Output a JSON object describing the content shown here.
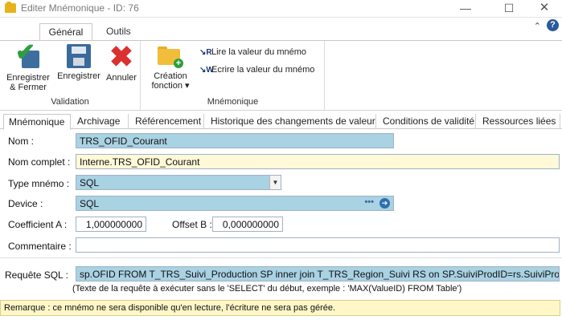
{
  "window": {
    "title": "Editer Mnémonique - ID: 76",
    "minimize": "—",
    "maximize": "☐",
    "close": "✕"
  },
  "ribbon": {
    "tabs": [
      {
        "label": "Général",
        "active": true
      },
      {
        "label": "Outils",
        "active": false
      }
    ],
    "collapse_glyph": "⌃",
    "help_glyph": "?",
    "groups": {
      "validation": {
        "label": "Validation",
        "buttons": {
          "save_close": "Enregistrer & Fermer",
          "save": "Enregistrer",
          "cancel": "Annuler"
        }
      },
      "mnemonique": {
        "label": "Mnémonique",
        "create_function": "Création fonction",
        "create_function_arrow": "▾",
        "read_value": "Lire la valeur du mnémo",
        "write_value": "Ecrire la valeur du mnémo"
      }
    }
  },
  "form_tabs": [
    {
      "label": "Mnémonique",
      "active": true
    },
    {
      "label": "Archivage",
      "active": false
    },
    {
      "label": "Référencement",
      "active": false
    },
    {
      "label": "Historique des changements de valeur",
      "active": false
    },
    {
      "label": "Conditions de validité",
      "active": false
    },
    {
      "label": "Ressources liées",
      "active": false
    }
  ],
  "form": {
    "nom": {
      "label": "Nom :",
      "value": "TRS_OFID_Courant"
    },
    "nom_complet": {
      "label": "Nom complet :",
      "value": "Interne.TRS_OFID_Courant"
    },
    "type": {
      "label": "Type mnémo :",
      "value": "SQL"
    },
    "device": {
      "label": "Device :",
      "value": "SQL",
      "dots": "•••",
      "go": "➔"
    },
    "coef_a": {
      "label": "Coefficient A :",
      "value": "1,000000000"
    },
    "offset_b": {
      "label": "Offset B :",
      "value": "0,000000000"
    },
    "commentaire": {
      "label": "Commentaire :",
      "value": ""
    },
    "requete": {
      "label": "Requête SQL :",
      "value": "sp.OFID   FROM T_TRS_Suivi_Production SP   inner join T_TRS_Region_Suivi RS on SP.SuiviProdID=rs.SuiviProdID"
    },
    "hint": "(Texte de la requête à exécuter sans le 'SELECT' du début, exemple : 'MAX(ValueID) FROM Table')",
    "remark": "Remarque : ce mnémo ne sera disponible qu'en lecture, l'écriture ne sera pas gérée."
  },
  "colors": {
    "field_blue": "#a9d2e3",
    "field_yellow": "#fff9d8",
    "remark_bg": "#fff7c8",
    "cancel_red": "#d9322f",
    "check_green": "#2e9e3e"
  }
}
